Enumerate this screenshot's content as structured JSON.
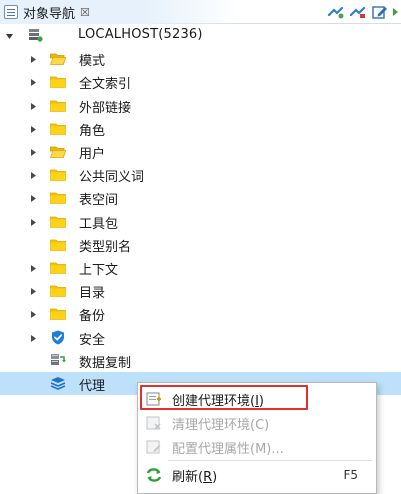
{
  "panel": {
    "title": "对象导航",
    "close_glyph": "☒"
  },
  "toolbar": [
    {
      "name": "connect-icon"
    },
    {
      "name": "disconnect-icon"
    },
    {
      "name": "edit-icon"
    },
    {
      "name": "refresh-green-icon"
    }
  ],
  "tree": {
    "root": {
      "label": "LOCALHOST(5236)",
      "expanded": true,
      "icon": "database-server-icon"
    },
    "items": [
      {
        "label": "模式",
        "icon": "folder-open-icon",
        "has_children": true
      },
      {
        "label": "全文索引",
        "icon": "folder-icon",
        "has_children": true
      },
      {
        "label": "外部链接",
        "icon": "folder-icon",
        "has_children": true
      },
      {
        "label": "角色",
        "icon": "folder-icon",
        "has_children": true
      },
      {
        "label": "用户",
        "icon": "folder-open-icon",
        "has_children": true
      },
      {
        "label": "公共同义词",
        "icon": "folder-icon",
        "has_children": true
      },
      {
        "label": "表空间",
        "icon": "folder-icon",
        "has_children": true
      },
      {
        "label": "工具包",
        "icon": "folder-icon",
        "has_children": true
      },
      {
        "label": "类型别名",
        "icon": "folder-icon",
        "has_children": false
      },
      {
        "label": "上下文",
        "icon": "folder-icon",
        "has_children": true
      },
      {
        "label": "目录",
        "icon": "folder-icon",
        "has_children": true
      },
      {
        "label": "备份",
        "icon": "folder-icon",
        "has_children": true
      },
      {
        "label": "安全",
        "icon": "shield-icon",
        "has_children": true
      },
      {
        "label": "数据复制",
        "icon": "replication-icon",
        "has_children": false
      },
      {
        "label": "代理",
        "icon": "agent-layers-icon",
        "has_children": false,
        "selected": true
      }
    ]
  },
  "context_menu": {
    "items": [
      {
        "label": "创建代理环境(I)",
        "mnemonic": "I",
        "enabled": true,
        "icon": "create-env-icon",
        "highlighted": true
      },
      {
        "label": "清理代理环境(C)",
        "enabled": false,
        "icon": "clean-env-icon"
      },
      {
        "label": "配置代理属性(M)...",
        "enabled": false,
        "icon": "config-props-icon"
      },
      {
        "label": "刷新(R)",
        "mnemonic": "R",
        "enabled": true,
        "icon": "refresh-icon",
        "shortcut": "F5"
      }
    ]
  },
  "colors": {
    "selection": "#bde1fb",
    "folder": "#f5c400",
    "highlight_border": "#e0302b",
    "disabled_text": "#a8a8a8"
  }
}
